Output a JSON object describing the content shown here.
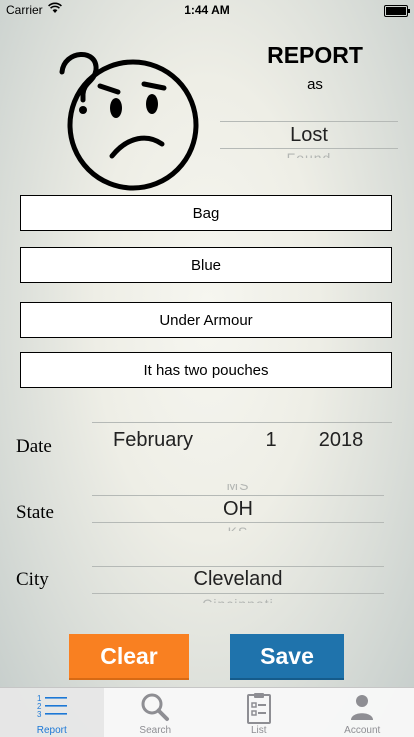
{
  "status_bar": {
    "carrier": "Carrier",
    "time": "1:44 AM"
  },
  "header": {
    "title": "REPORT",
    "subtitle": "as"
  },
  "report_type_picker": {
    "selected": "Lost",
    "next": "Found"
  },
  "fields": {
    "item": "Bag",
    "color": "Blue",
    "brand": "Under Armour",
    "description": "It has two pouches"
  },
  "date": {
    "label": "Date",
    "month": "February",
    "day": "1",
    "year": "2018"
  },
  "state": {
    "label": "State",
    "prev": "MS",
    "selected": "OH",
    "next": "KS"
  },
  "city": {
    "label": "City",
    "selected": "Cleveland",
    "next": "Cincinnati"
  },
  "actions": {
    "clear_label": "Clear",
    "save_label": "Save",
    "clear_color": "#f98021",
    "save_color": "#1f73ac"
  },
  "tabs": [
    {
      "label": "Report",
      "icon": "numbered-list-icon",
      "active": true
    },
    {
      "label": "Search",
      "icon": "magnifier-icon",
      "active": false
    },
    {
      "label": "List",
      "icon": "clipboard-icon",
      "active": false
    },
    {
      "label": "Account",
      "icon": "person-icon",
      "active": false
    }
  ],
  "colors": {
    "tab_active": "#1c78d6",
    "tab_inactive": "#8e8e93"
  }
}
